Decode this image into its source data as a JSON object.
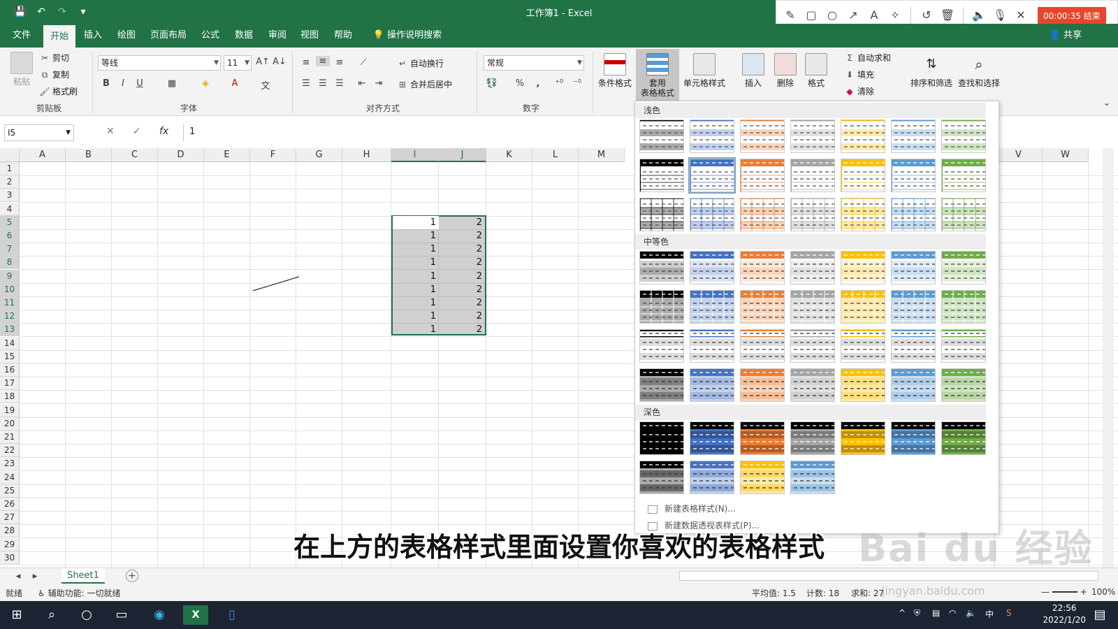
{
  "app": {
    "title": "工作簿1 - Excel"
  },
  "qat": {
    "save": "💾",
    "undo": "↶",
    "redo": "↷",
    "more": "▾"
  },
  "recorder": {
    "timer": "00:00:35 结束"
  },
  "menu": {
    "tabs": [
      "文件",
      "开始",
      "插入",
      "绘图",
      "页面布局",
      "公式",
      "数据",
      "审阅",
      "视图",
      "帮助"
    ],
    "active": "开始",
    "search": "操作说明搜索",
    "share": "共享"
  },
  "ribbon": {
    "clipboard": {
      "paste": "粘贴",
      "cut": "剪切",
      "copy": "复制",
      "format_painter": "格式刷",
      "label": "剪贴板"
    },
    "font": {
      "name": "等线",
      "size": "11",
      "label": "字体",
      "bold": "B",
      "italic": "I",
      "underline": "U"
    },
    "alignment": {
      "wrap": "自动换行",
      "merge": "合并后居中",
      "label": "对齐方式"
    },
    "number": {
      "format": "常规",
      "label": "数字",
      "percent": "%",
      "comma": ","
    },
    "styles": {
      "conditional": "条件格式",
      "table_format_1": "套用",
      "table_format_2": "表格格式",
      "cell_styles": "单元格样式"
    },
    "cells": {
      "insert": "插入",
      "delete": "删除",
      "format": "格式"
    },
    "editing": {
      "autosum": "自动求和",
      "fill": "填充",
      "clear": "清除",
      "sort": "排序和筛选",
      "find": "查找和选择"
    }
  },
  "formula_bar": {
    "name_box": "I5",
    "value": "1",
    "fx": "fx"
  },
  "grid": {
    "columns": [
      "A",
      "B",
      "C",
      "D",
      "E",
      "F",
      "G",
      "H",
      "I",
      "J",
      "K",
      "L",
      "M",
      "V",
      "W"
    ],
    "rows": [
      "1",
      "2",
      "3",
      "4",
      "5",
      "6",
      "7",
      "8",
      "9",
      "10",
      "11",
      "12",
      "13",
      "14",
      "15",
      "16",
      "17",
      "18",
      "19",
      "20",
      "21",
      "22",
      "23",
      "24",
      "25",
      "26",
      "27",
      "28",
      "29",
      "30"
    ],
    "col_i_values": [
      "1",
      "1",
      "1",
      "1",
      "1",
      "1",
      "1",
      "1",
      "1"
    ],
    "col_j_values": [
      "2",
      "2",
      "2",
      "2",
      "2",
      "2",
      "2",
      "2",
      "2"
    ]
  },
  "gallery": {
    "light_label": "浅色",
    "medium_label": "中等色",
    "dark_label": "深色",
    "new_table_style": "新建表格样式(N)...",
    "new_pivot_style": "新建数据透视表样式(P)...",
    "palette": [
      "#000000",
      "#4472c4",
      "#ed7d31",
      "#a5a5a5",
      "#ffc000",
      "#5b9bd5",
      "#70ad47"
    ]
  },
  "sheets": {
    "active": "Sheet1"
  },
  "status": {
    "ready": "就绪",
    "accessibility": "辅助功能: 一切就绪",
    "average": "平均值: 1.5",
    "count": "计数: 18",
    "sum": "求和: 27",
    "zoom": "100%"
  },
  "taskbar": {
    "time": "22:56",
    "date": "2022/1/20",
    "ime": "中"
  },
  "subtitle": "在上方的表格样式里面设置你喜欢的表格样式",
  "watermark": "Bai du 经验",
  "watermark_url": "jingyan.baidu.com"
}
